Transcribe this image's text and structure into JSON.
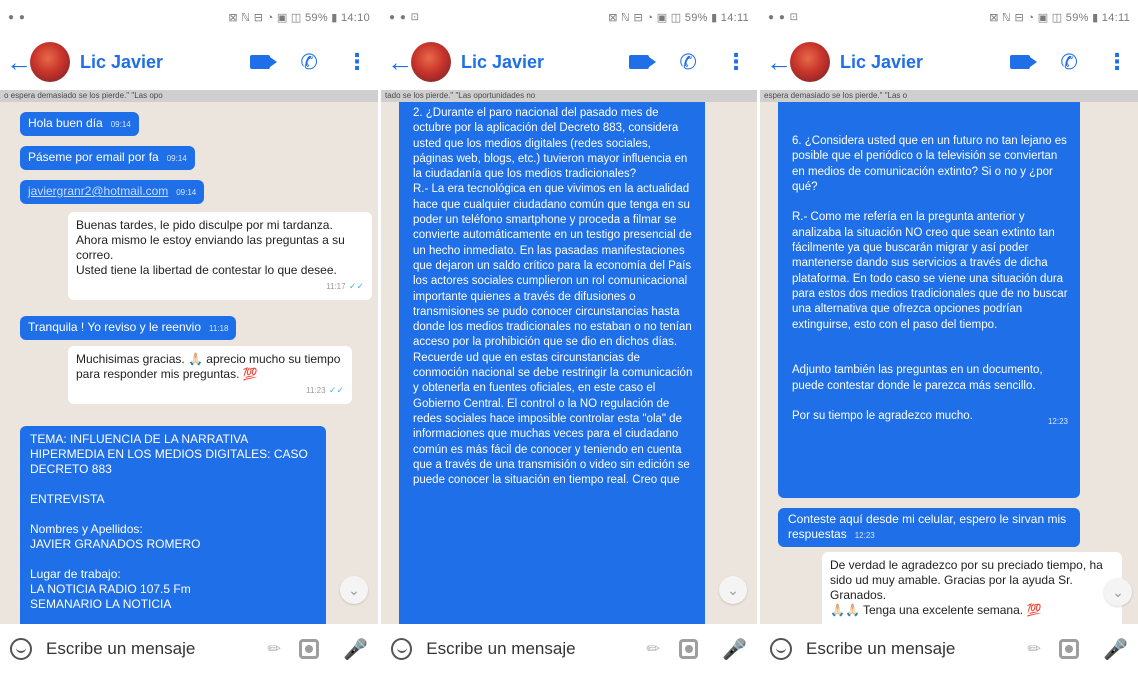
{
  "colors": {
    "accent": "#1e6fe8",
    "chat_background": "#ece5dd",
    "incoming_bubble": "#ffffff",
    "read_tick": "#4fb0e8"
  },
  "panels": [
    {
      "status": {
        "left": "● ●",
        "right": "⊠ ℕ ⊟ ◔ ▣ ◫ 59% ▮ 14:10"
      },
      "contact": "Lic Javier",
      "pinned": "o espera demasiado se los pierde.\"                    \"Las opo",
      "input_placeholder": "Escribe un mensaje",
      "messages": [
        {
          "text": "Hola buen día",
          "time": "09:14"
        },
        {
          "text": "Páseme por email por fa",
          "time": "09:14"
        },
        {
          "text": "javiergranr2@hotmail.com",
          "time": "09:14"
        },
        {
          "text": "Buenas tardes, le pido disculpe por mi tardanza. Ahora mismo le estoy enviando las preguntas a su correo.\nUsted tiene la libertad de contestar lo que desee.",
          "time": "11:17",
          "tick": "✓✓"
        },
        {
          "text": "Tranquila ! Yo reviso y le reenvio",
          "time": "11:18"
        },
        {
          "text": "Muchisimas gracias. 🙏🏻 aprecio mucho su tiempo para responder mis preguntas. 💯",
          "time": "11:23",
          "tick": "✓✓"
        },
        {
          "text": "TEMA: INFLUENCIA DE LA NARRATIVA HIPERMEDIA EN LOS MEDIOS DIGITALES: CASO DECRETO 883\n\nENTREVISTA\n\nNombres y Apellidos:\nJAVIER GRANADOS ROMERO\n\nLugar de trabajo:\nLA NOTICIA RADIO 107.5 Fm\nSEMANARIO LA NOTICIA"
        }
      ]
    },
    {
      "status": {
        "left": "● ● ⊡",
        "right": "⊠ ℕ ⊟ ◔ ▣ ◫ 59% ▮ 14:11"
      },
      "contact": "Lic Javier",
      "pinned": "tado se los pierde.\"                         \"Las oportunidades no",
      "input_placeholder": "Escribe un mensaje",
      "messages": [
        {
          "text": "2.   ¿Durante el paro nacional del pasado mes de octubre por la aplicación del Decreto 883, considera usted que los medios digitales (redes sociales, páginas web, blogs, etc.) tuvieron mayor influencia en la ciudadanía que los medios tradicionales?\nR.- La era tecnológica en que vivimos en la actualidad hace que cualquier ciudadano común que tenga en su poder un teléfono smartphone y proceda a filmar se convierte automáticamente en un testigo presencial de un hecho inmediato. En las pasadas manifestaciones que dejaron un saldo crítico para la economía del País los actores sociales cumplieron un rol comunicacional importante quienes a través de difusiones o transmisiones se pudo conocer circunstancias hasta donde los medios tradicionales no estaban o no tenían acceso por la prohibición que se dio en dichos días. Recuerde ud que en estas circunstancias de conmoción nacional se debe restringir la comunicación y obtenerla en fuentes oficiales, en este caso el Gobierno Central. El control o la NO regulación de redes sociales hace imposible controlar esta \"ola\" de informaciones que muchas veces para el ciudadano común es más fácil de conocer y teniendo en cuenta que a través de una transmisión o video sin edición se puede conocer la situación en tiempo real. Creo que"
        }
      ]
    },
    {
      "status": {
        "left": "● ● ⊡",
        "right": "⊠ ℕ ⊟ ◔ ▣ ◫ 59% ▮ 14:11"
      },
      "contact": "Lic Javier",
      "pinned": "espera demasiado se los pierde.\"                                   \"Las o",
      "input_placeholder": "Escribe un mensaje",
      "messages": [
        {
          "text": "6.   ¿Considera usted que en un futuro no tan lejano es posible que el periódico o la televisión se conviertan en medios de comunicación extinto? Si o no y ¿por qué?\n\nR.- Como me refería en la pregunta anterior y analizaba la situación NO creo que sean extinto tan fácilmente ya que buscarán migrar y así poder mantenerse dando sus servicios a través de dicha plataforma. En todo caso se viene una situación dura para estos dos medios tradicionales que de no buscar una alternativa que ofrezca opciones podrían extinguirse, esto con el paso del tiempo.\n\n\nAdjunto también las preguntas en un documento, puede contestar donde le parezca más sencillo.\n\nPor su tiempo le agradezco mucho.",
          "time": "12:23"
        },
        {
          "text": "Conteste aquí desde mi celular, espero le sirvan mis respuestas",
          "time": "12:23"
        },
        {
          "text": "De verdad le agradezco por su preciado tiempo, ha sido ud muy amable. Gracias por la ayuda Sr. Granados.\n🙏🏻🙏🏻 Tenga una excelente semana. 💯"
        }
      ]
    }
  ]
}
